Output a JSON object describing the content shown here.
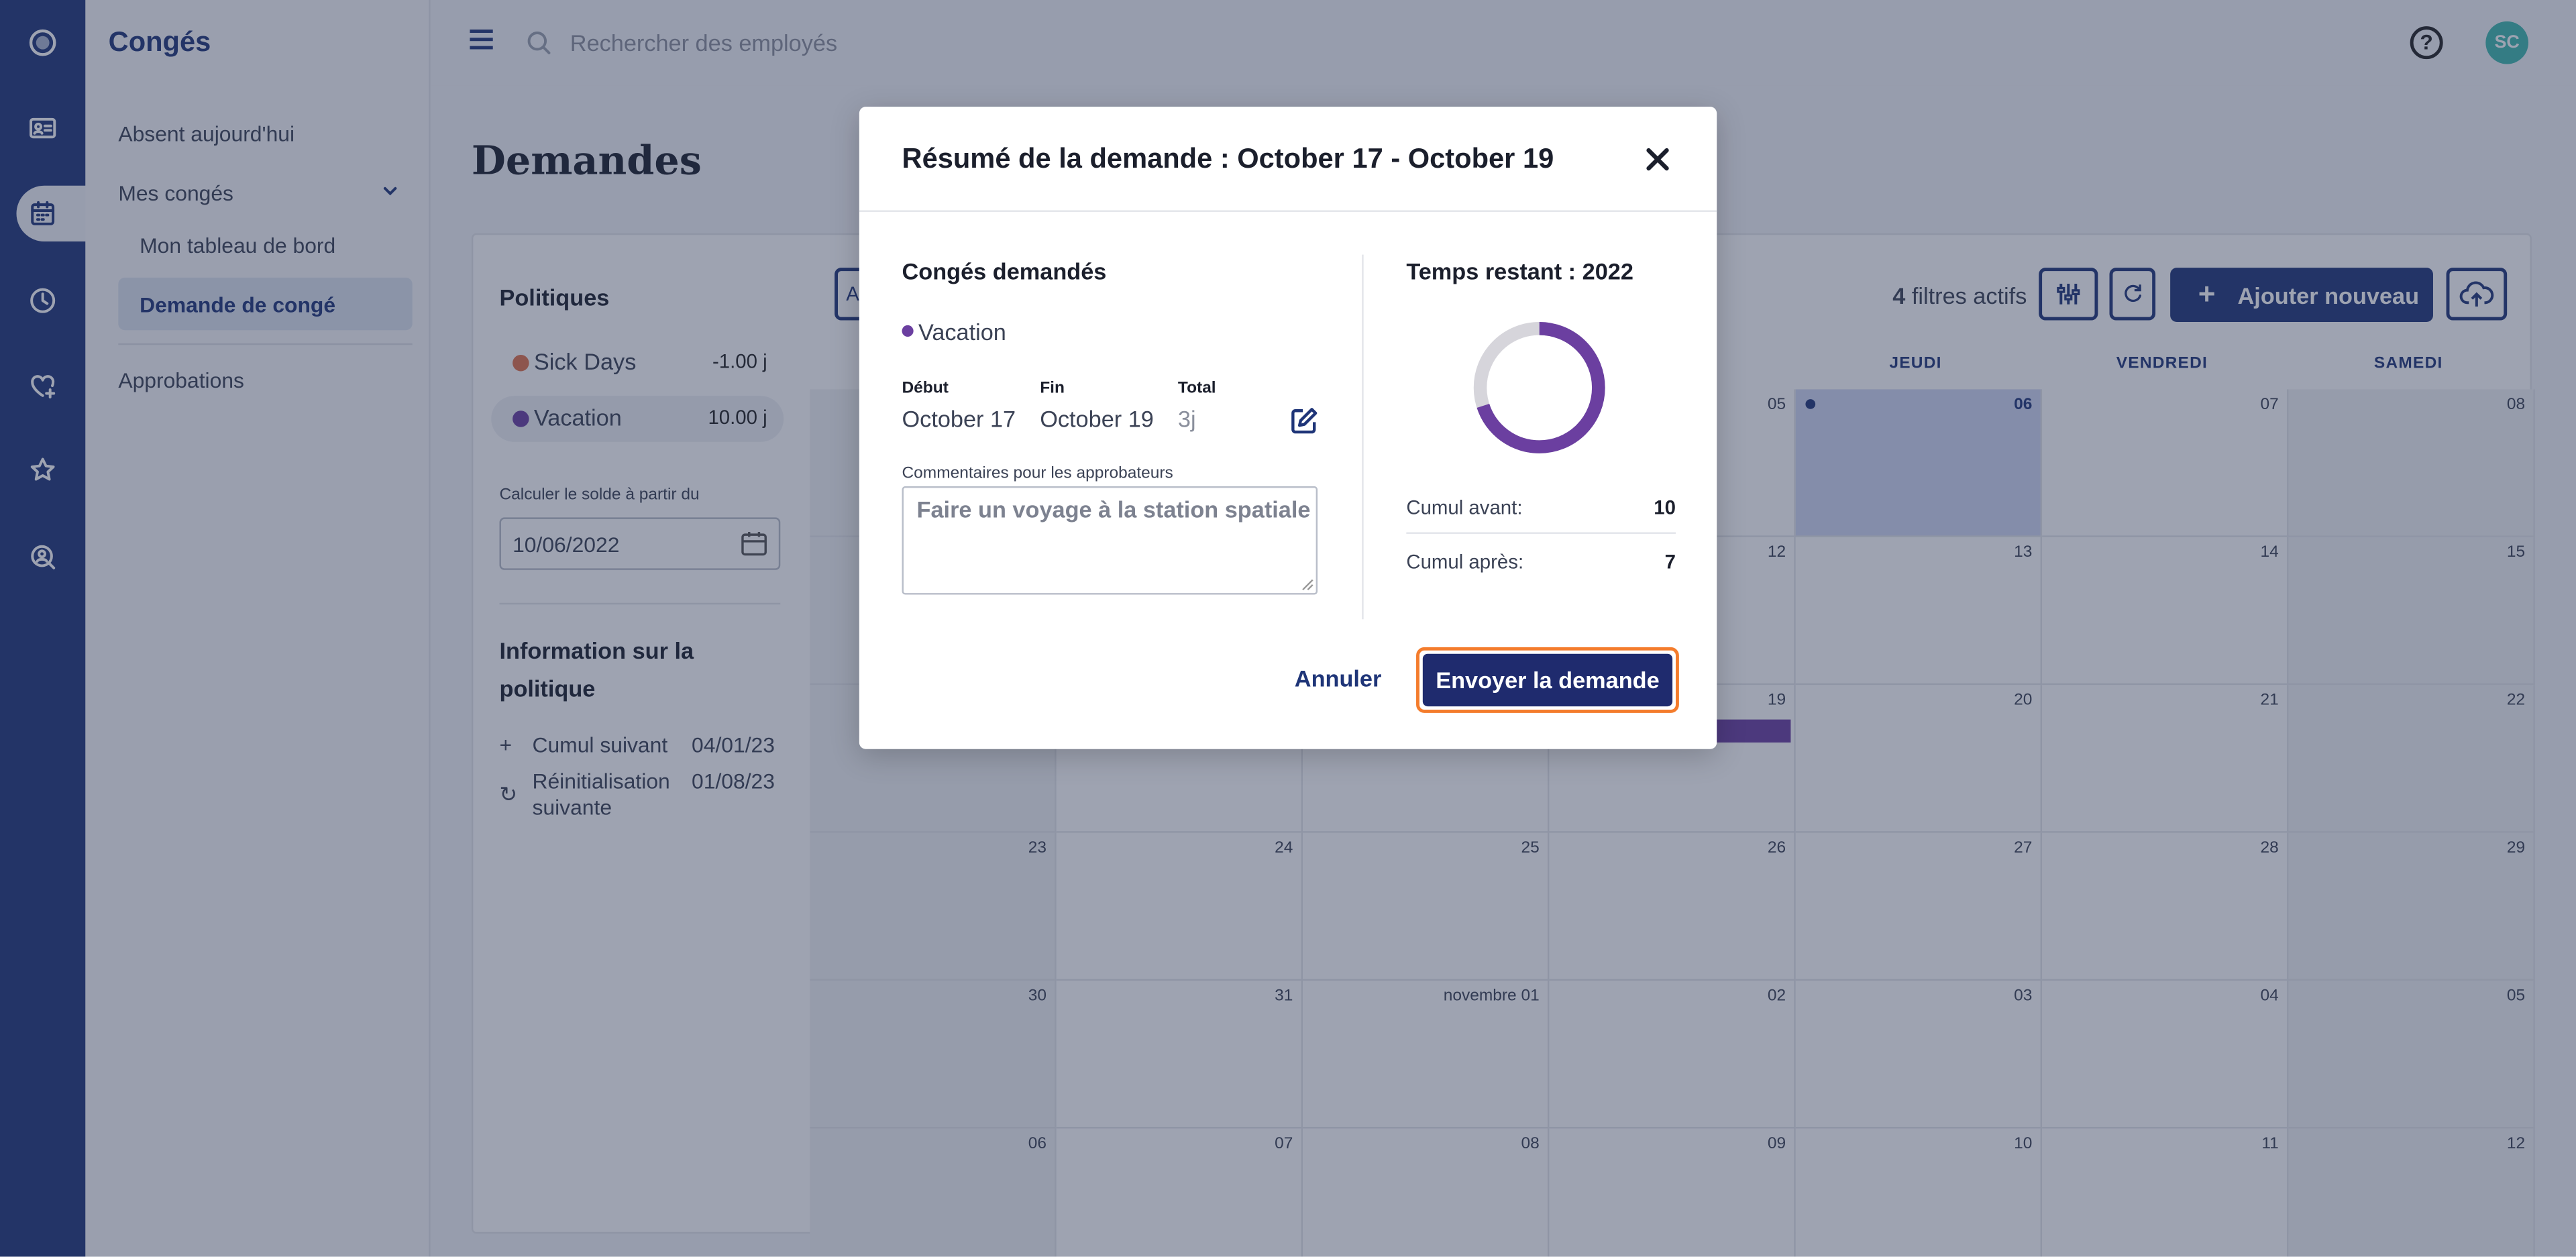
{
  "app": {
    "title": "Congés",
    "colors": {
      "primary": "#1f3578",
      "accent_orange": "#f47c2c",
      "vacation": "#6b3fa0",
      "sick": "#e0714c",
      "avatar": "#3fb8ae"
    }
  },
  "rail": {
    "icons": [
      "logo-icon",
      "id-card-icon",
      "calendar-icon",
      "clock-icon",
      "heart-plus-icon",
      "star-icon",
      "people-search-icon"
    ],
    "active": "calendar-icon"
  },
  "sidebar": {
    "items": [
      {
        "label": "Absent aujourd'hui"
      },
      {
        "label": "Mes congés"
      },
      {
        "label": "Mon tableau de bord"
      },
      {
        "label": "Demande de congé"
      },
      {
        "label": "Approbations"
      }
    ]
  },
  "topbar": {
    "search_placeholder": "Rechercher des employés",
    "help": "?",
    "avatar": "SC"
  },
  "page": {
    "title": "Demandes"
  },
  "policies": {
    "title": "Politiques",
    "items": [
      {
        "name": "Sick Days",
        "value": "-1.00 j",
        "color": "#e0714c"
      },
      {
        "name": "Vacation",
        "value": "10.00 j",
        "color": "#6b3fa0"
      }
    ],
    "calc_label": "Calculer le solde à partir du",
    "calc_date": "10/06/2022",
    "info_title": "Information sur la politique",
    "info_rows": [
      {
        "icon": "plus-icon",
        "label": "Cumul suivant",
        "date": "04/01/23"
      },
      {
        "icon": "reset-icon",
        "label": "Réinitialisation suivante",
        "date": "01/08/23"
      }
    ]
  },
  "calendar": {
    "first_button_initial": "A",
    "filters_count": "4",
    "filters_label": "filtres actifs",
    "add_label": "Ajouter nouveau",
    "day_names": [
      "JEUDI",
      "VENDREDI",
      "SAMEDI"
    ],
    "weeks": [
      [
        "",
        "",
        "",
        "05",
        "06",
        "07",
        "08"
      ],
      [
        "",
        "",
        "",
        "12",
        "13",
        "14",
        "15"
      ],
      [
        "",
        "",
        "",
        "19",
        "20",
        "21",
        "22"
      ],
      [
        "23",
        "24",
        "25",
        "26",
        "27",
        "28",
        "29"
      ],
      [
        "30",
        "31",
        "novembre 01",
        "02",
        "03",
        "04",
        "05"
      ],
      [
        "06",
        "07",
        "08",
        "09",
        "10",
        "11",
        "12"
      ]
    ],
    "today": "06"
  },
  "modal": {
    "title": "Résumé de la demande : October 17 - October 19",
    "requested_title": "Congés demandés",
    "policy": "Vacation",
    "start_label": "Début",
    "start_value": "October 17",
    "end_label": "Fin",
    "end_value": "October 19",
    "total_label": "Total",
    "total_value": "3j",
    "comments_label": "Commentaires pour les approbateurs",
    "comments_value": "Faire un voyage à la station spatiale",
    "remaining_title": "Temps restant : 2022",
    "balance_before_label": "Cumul avant:",
    "balance_before": "10",
    "balance_after_label": "Cumul après:",
    "balance_after": "7",
    "cancel_label": "Annuler",
    "submit_label": "Envoyer la demande"
  }
}
